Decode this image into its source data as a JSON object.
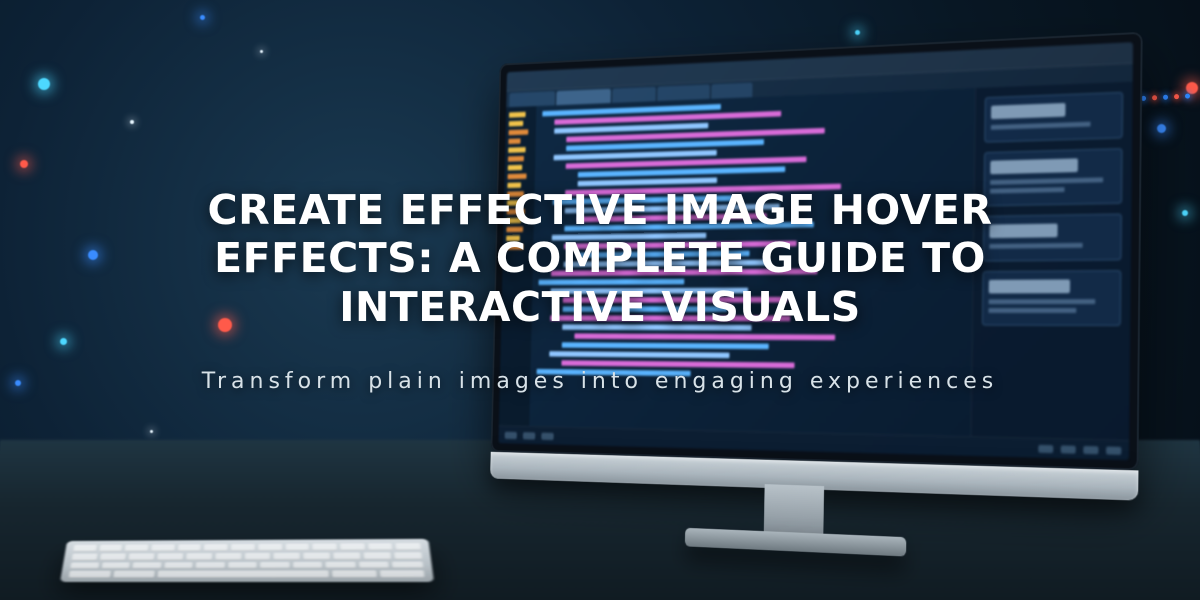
{
  "title": "CREATE EFFECTIVE IMAGE HOVER EFFECTS: A COMPLETE GUIDE TO INTERACTIVE VISUALS",
  "subtitle": "Transform plain images into engaging experiences",
  "colors": {
    "cyan": "#4dd8ff",
    "red": "#ff5a4a",
    "blue": "#3a8cff",
    "bg_dark": "#081724"
  }
}
